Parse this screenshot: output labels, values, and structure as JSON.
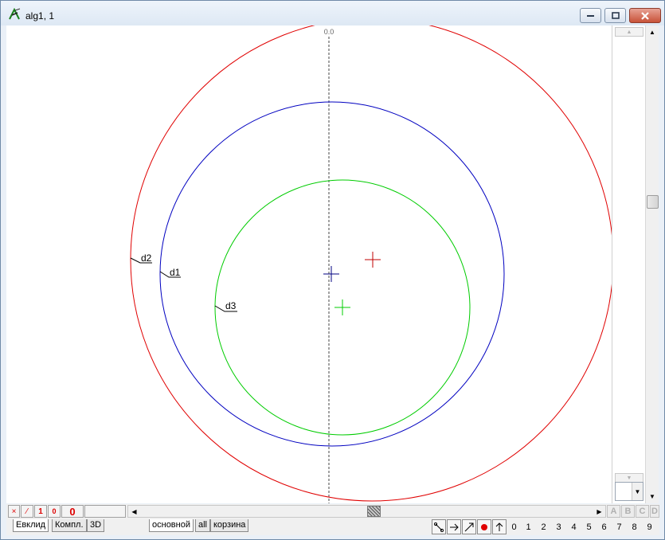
{
  "window": {
    "title": "alg1, 1",
    "icons": {
      "app": "geometry-app-icon",
      "minimize": "minimize-icon",
      "maximize": "maximize-icon",
      "close": "close-icon"
    }
  },
  "canvas": {
    "axis_label": "0.0",
    "circle_labels": [
      "d2",
      "d1",
      "d3"
    ],
    "colors": {
      "d2": "#e00000",
      "d1": "#0000c0",
      "d3": "#00cc00",
      "axis": "#444444"
    }
  },
  "status": {
    "buttons": [
      "×",
      "⁄",
      "1",
      "0",
      "0"
    ],
    "letter_buttons": [
      "A",
      "B",
      "C",
      "D"
    ]
  },
  "tabs": {
    "left": [
      "Евклид",
      "Компл.",
      "3D"
    ],
    "right": [
      "основной",
      "all",
      "корзина"
    ],
    "numbers": [
      "0",
      "1",
      "2",
      "3",
      "4",
      "5",
      "6",
      "7",
      "8",
      "9"
    ],
    "tool_icons": [
      "segment-tool-icon",
      "arrow-right-tool-icon",
      "resize-tool-icon",
      "point-tool-icon",
      "arrow-up-tool-icon"
    ]
  }
}
